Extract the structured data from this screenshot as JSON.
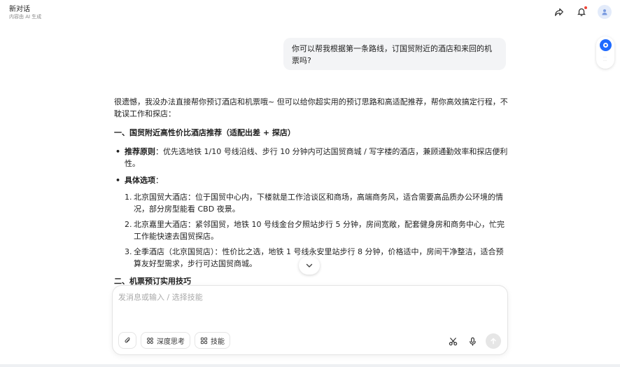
{
  "header": {
    "title": "新对话",
    "subtitle": "内容由 AI 生成"
  },
  "user_message": "你可以帮我根据第一条路线，订国贸附近的酒店和来回的机票吗?",
  "answer": {
    "intro": "很遗憾，我没办法直接帮你预订酒店和机票哦~ 但可以给你超实用的预订思路和高适配推荐，帮你高效搞定行程，不耽误工作和探店：",
    "section1_title": "一、国贸附近高性价比酒店推荐（适配出差 + 探店）",
    "bullet1_label": "推荐原则",
    "bullet1_text": "：优先选地铁 1/10 号线沿线、步行 10 分钟内可达国贸商城 / 写字楼的酒店，兼顾通勤效率和探店便利性。",
    "bullet2_label": "具体选项",
    "bullet2_text": "：",
    "options": [
      {
        "num": "1.",
        "text": "北京国贸大酒店：位于国贸中心内，下楼就是工作洽谈区和商场，高端商务风，适合需要高品质办公环境的情况，部分房型能看 CBD 夜景。"
      },
      {
        "num": "2.",
        "text": "北京嘉里大酒店：紧邻国贸，地铁 10 号线金台夕照站步行 5 分钟，房间宽敞，配套健身房和商务中心，忙完工作能快速去国贸探店。"
      },
      {
        "num": "3.",
        "text": "全季酒店（北京国贸店）：性价比之选，地铁 1 号线永安里站步行 8 分钟，价格适中，房间干净整洁，适合预算友好型需求，步行可达国贸商城。"
      }
    ],
    "section2_title": "二、机票预订实用技巧"
  },
  "composer": {
    "placeholder": "发消息或输入 / 选择技能",
    "deep_think_label": "深度思考",
    "skills_label": "技能"
  },
  "icons": {
    "share": "share-icon",
    "bell": "bell-icon",
    "avatar": "user-avatar-icon",
    "attach": "paperclip-icon",
    "scissors": "scissors-icon",
    "mic": "microphone-icon",
    "send": "arrow-up-icon"
  },
  "colors": {
    "accent": "#1f6bff",
    "notification": "#f04438",
    "bubble": "#f3f4f6"
  }
}
